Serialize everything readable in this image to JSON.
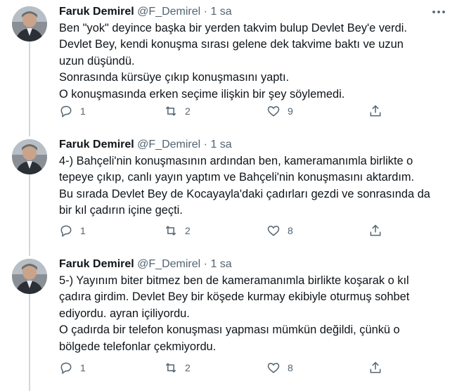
{
  "tweets": [
    {
      "author": {
        "name": "Faruk Demirel",
        "handle": "@F_Demirel"
      },
      "separator": "·",
      "time": "1 sa",
      "lines": [
        "Ben \"yok\" deyince başka bir yerden takvim bulup Devlet Bey'e verdi.",
        "Devlet Bey, kendi konuşma sırası gelene dek takvime baktı ve uzun",
        "uzun düşündü.",
        "Sonrasında kürsüye çıkıp konuşmasını yaptı.",
        "O konuşmasında erken seçime ilişkin bir şey söylemedi."
      ],
      "replies": "1",
      "retweets": "2",
      "likes": "9"
    },
    {
      "author": {
        "name": "Faruk Demirel",
        "handle": "@F_Demirel"
      },
      "separator": "·",
      "time": "1 sa",
      "lines": [
        "4-) Bahçeli'nin konuşmasının ardından ben, kameramanımla birlikte o",
        "tepeye çıkıp, canlı yayın yaptım ve Bahçeli'nin konuşmasını aktardım.",
        "Bu sırada Devlet Bey de Kocayayla'daki çadırları gezdi ve sonrasında da",
        "bir kıl çadırın içine geçti."
      ],
      "replies": "1",
      "retweets": "2",
      "likes": "8"
    },
    {
      "author": {
        "name": "Faruk Demirel",
        "handle": "@F_Demirel"
      },
      "separator": "·",
      "time": "1 sa",
      "lines": [
        "5-) Yayınım biter bitmez ben de kameramanımla birlikte koşarak o kıl",
        "çadıra girdim. Devlet Bey bir köşede kurmay ekibiyle oturmuş sohbet",
        "ediyordu. ayran içiliyordu.",
        "O çadırda bir telefon konuşması yapması mümkün değildi, çünkü o",
        "bölgede telefonlar çekmiyordu."
      ],
      "replies": "1",
      "retweets": "2",
      "likes": "8"
    }
  ],
  "icons": {
    "reply": "reply-icon",
    "retweet": "retweet-icon",
    "like": "heart-icon",
    "share": "share-icon",
    "more": "more-icon"
  },
  "colors": {
    "text": "#0f1419",
    "secondary": "#536471",
    "thread_line": "#cfd9de"
  }
}
